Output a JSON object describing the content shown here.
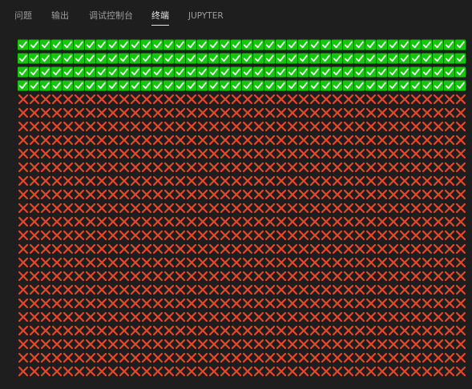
{
  "tabs": [
    {
      "label": "问题",
      "active": false
    },
    {
      "label": "输出",
      "active": false
    },
    {
      "label": "调试控制台",
      "active": false
    },
    {
      "label": "终端",
      "active": true
    },
    {
      "label": "JUPYTER",
      "active": false
    }
  ],
  "terminal": {
    "columns": 40,
    "pass_symbol": "check-mark",
    "fail_symbol": "cross-mark",
    "pass_rows": 4,
    "fail_rows": 21,
    "colors": {
      "background": "#1e1e1e",
      "pass_fill": "#16c60c",
      "pass_mark": "#ffffff",
      "fail_mark": "#e7472a"
    }
  }
}
